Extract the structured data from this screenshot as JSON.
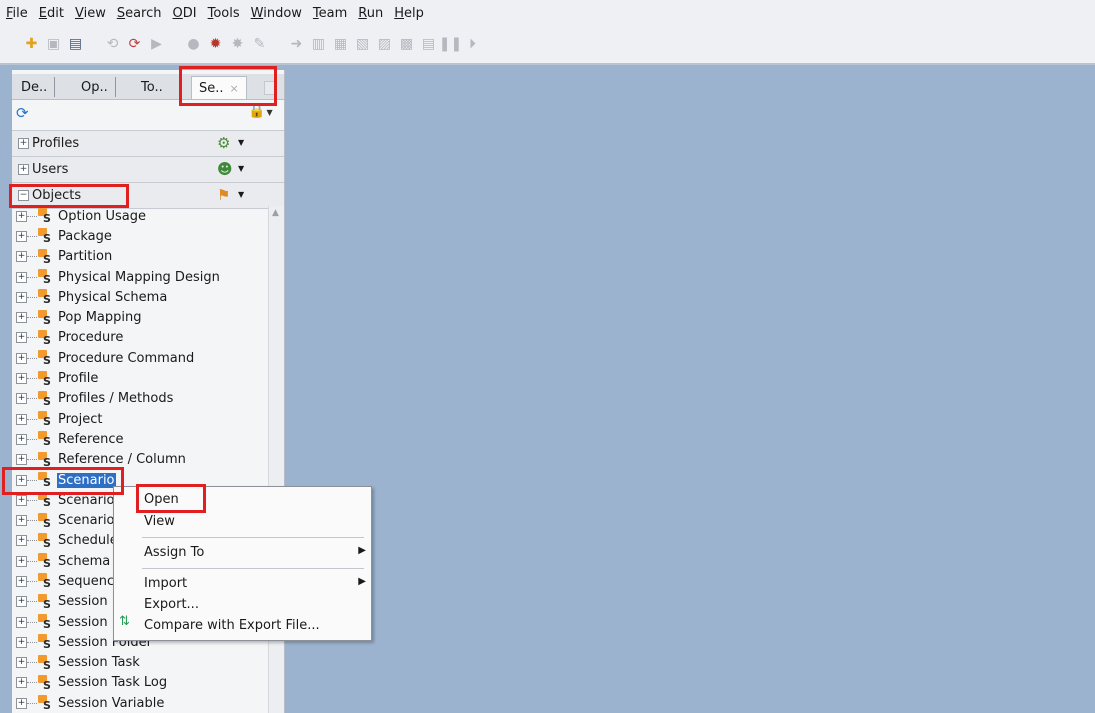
{
  "menubar": [
    "File",
    "Edit",
    "View",
    "Search",
    "ODI",
    "Tools",
    "Window",
    "Team",
    "Run",
    "Help"
  ],
  "toolbar": {
    "icons": [
      "new-icon",
      "save-icon",
      "save-all-icon",
      "undo-icon",
      "redo-icon",
      "run-icon",
      "debug-dot-icon",
      "debug-icon",
      "debug-step-icon",
      "debug-clear-icon",
      "step-into-icon",
      "step-over-icon",
      "step-out-icon",
      "step-next-icon",
      "step-last-icon",
      "step-end-icon",
      "pause-icon",
      "resume-icon"
    ]
  },
  "tabs": [
    "De..",
    "Op..",
    "To..",
    "Se.."
  ],
  "tab_close": "×",
  "accordions": {
    "profiles": "Profiles",
    "users": "Users",
    "objects": "Objects"
  },
  "tree": {
    "items": [
      "Option Usage",
      "Package",
      "Partition",
      "Physical Mapping Design",
      "Physical Schema",
      "Pop Mapping",
      "Procedure",
      "Procedure Command",
      "Profile",
      "Profiles / Methods",
      "Project",
      "Reference",
      "Reference / Column",
      "Scenario",
      "Scenario",
      "Scenario",
      "Schedule",
      "Schema",
      "Sequence",
      "Session",
      "Session",
      "Session Folder",
      "Session Task",
      "Session Task Log",
      "Session Variable"
    ],
    "selected_index": 13
  },
  "context_menu": {
    "open": "Open",
    "view": "View",
    "assign_to": "Assign To",
    "import": "Import",
    "export": "Export...",
    "compare": "Compare with Export File..."
  },
  "colors": {
    "workspace": "#9cb3cf",
    "selection": "#2d6fc4",
    "highlight": "#e02020",
    "folder": "#f29a2e"
  }
}
